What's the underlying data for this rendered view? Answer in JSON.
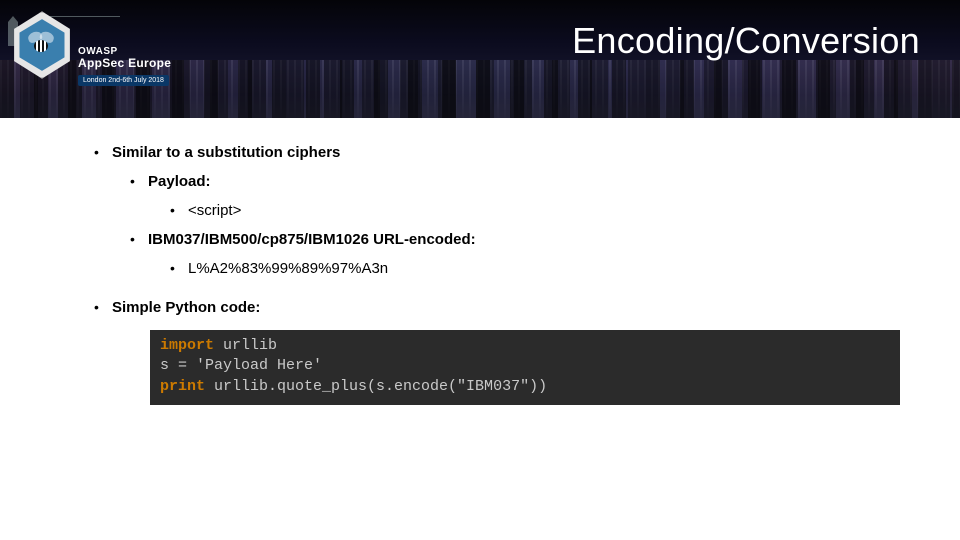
{
  "banner": {
    "conference_org": "OWASP",
    "conference_name1": "AppSec",
    "conference_name2": "Europe",
    "conference_date_pill": "London 2nd-6th July 2018",
    "title": "Encoding/Conversion"
  },
  "bullets": {
    "l1": "Similar to a substitution ciphers",
    "payload_label": "Payload:",
    "payload_value": "<script>",
    "enc_label": "IBM037/IBM500/cp875/IBM1026 URL-encoded:",
    "enc_value": "L%A2%83%99%89%97%A3n",
    "l2": "Simple Python code:"
  },
  "code": {
    "line1_kw": "import",
    "line1_rest": " urllib",
    "line2": "s = 'Payload Here'",
    "line3_kw": "print",
    "line3_rest": " urllib.quote_plus(s.encode(\"IBM037\"))"
  }
}
